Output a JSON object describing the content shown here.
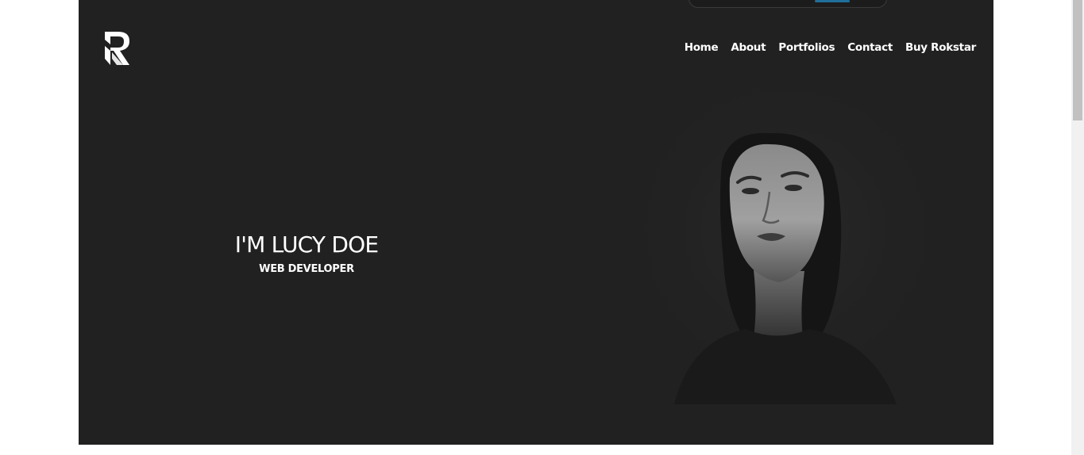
{
  "site": {
    "logo_icon": "r-letter-logo-icon"
  },
  "nav": {
    "items": [
      {
        "label": "Home"
      },
      {
        "label": "About"
      },
      {
        "label": "Portfolios"
      },
      {
        "label": "Contact"
      },
      {
        "label": "Buy Rokstar"
      }
    ]
  },
  "hero": {
    "title": "I'M LUCY DOE",
    "subtitle": "WEB DEVELOPER",
    "background_color": "#212121",
    "portrait_icon": "woman-portrait-photo"
  },
  "colors": {
    "hero_bg": "#212121",
    "text": "#ffffff",
    "accent": "#1f6f9a"
  }
}
